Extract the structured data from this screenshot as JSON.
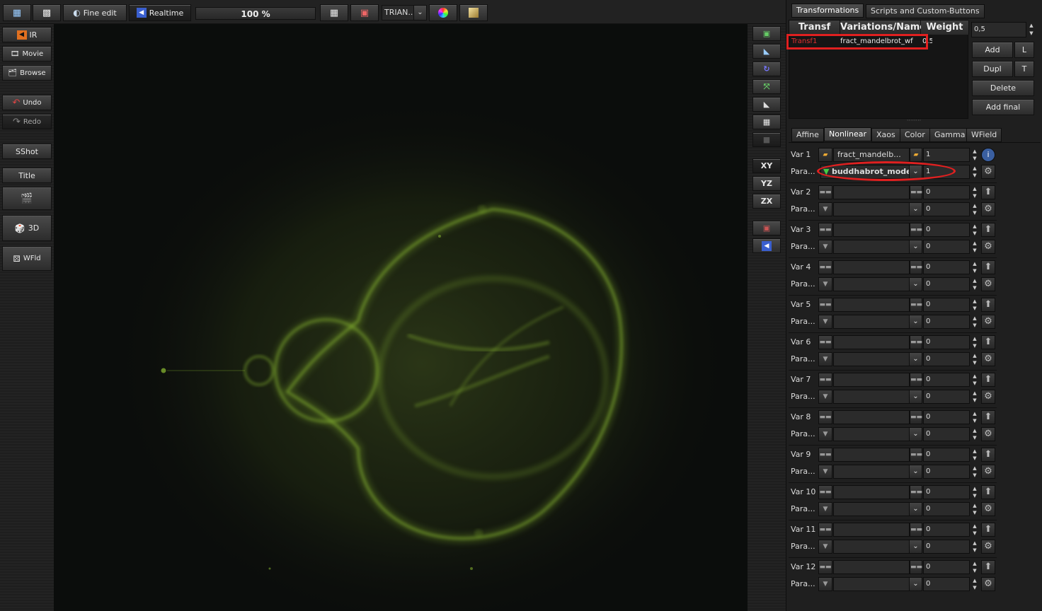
{
  "toolbar": {
    "fine_edit_label": "Fine edit",
    "realtime_label": "Realtime",
    "zoom_value": "100 %",
    "triangle_combo": "TRIAN..."
  },
  "leftbar": {
    "ir_label": "IR",
    "movie_label": "Movie",
    "browse_label": "Browse",
    "undo_label": "Undo",
    "redo_label": "Redo",
    "sshot_label": "SShot",
    "title_label": "Title",
    "threed_label": "3D",
    "wfld_label": "WFld"
  },
  "toolcol": {
    "xy_label": "XY",
    "yz_label": "YZ",
    "zx_label": "ZX"
  },
  "panel": {
    "tabs": [
      "Transformations",
      "Scripts and Custom-Buttons"
    ],
    "table_headers": [
      "Transf",
      "Variations/Name",
      "Weight"
    ],
    "row": {
      "transf": "Transf1",
      "name": "fract_mandelbrot_wf",
      "weight": "0.5"
    },
    "weight_field": "0,5",
    "buttons": {
      "add": "Add",
      "l": "L",
      "dupl": "Dupl",
      "t": "T",
      "delete": "Delete",
      "add_final": "Add final"
    },
    "subtabs": [
      "Affine",
      "Nonlinear",
      "Xaos",
      "Color",
      "Gamma",
      "WField"
    ]
  },
  "nonlinear": {
    "var1": {
      "label": "Var 1",
      "name": "fract_mandelb...",
      "value": "1"
    },
    "param1": {
      "label": "Para...",
      "name": "buddhabrot_mode",
      "value": "1"
    },
    "rows": [
      {
        "var_label": "Var 2",
        "var_value": "0",
        "para_label": "Para...",
        "para_value": "0"
      },
      {
        "var_label": "Var 3",
        "var_value": "0",
        "para_label": "Para...",
        "para_value": "0"
      },
      {
        "var_label": "Var 4",
        "var_value": "0",
        "para_label": "Para...",
        "para_value": "0"
      },
      {
        "var_label": "Var 5",
        "var_value": "0",
        "para_label": "Para...",
        "para_value": "0"
      },
      {
        "var_label": "Var 6",
        "var_value": "0",
        "para_label": "Para...",
        "para_value": "0"
      },
      {
        "var_label": "Var 7",
        "var_value": "0",
        "para_label": "Para...",
        "para_value": "0"
      },
      {
        "var_label": "Var 8",
        "var_value": "0",
        "para_label": "Para...",
        "para_value": "0"
      },
      {
        "var_label": "Var 9",
        "var_value": "0",
        "para_label": "Para...",
        "para_value": "0"
      },
      {
        "var_label": "Var 10",
        "var_value": "0",
        "para_label": "Para...",
        "para_value": "0"
      },
      {
        "var_label": "Var 11",
        "var_value": "0",
        "para_label": "Para...",
        "para_value": "0"
      },
      {
        "var_label": "Var 12",
        "var_value": "0",
        "para_label": "Para...",
        "para_value": "0"
      }
    ]
  },
  "colors": {
    "highlight": "#e02020",
    "fractal_glow": "#7faa2e",
    "canvas_bg": "#0b0d0c"
  }
}
